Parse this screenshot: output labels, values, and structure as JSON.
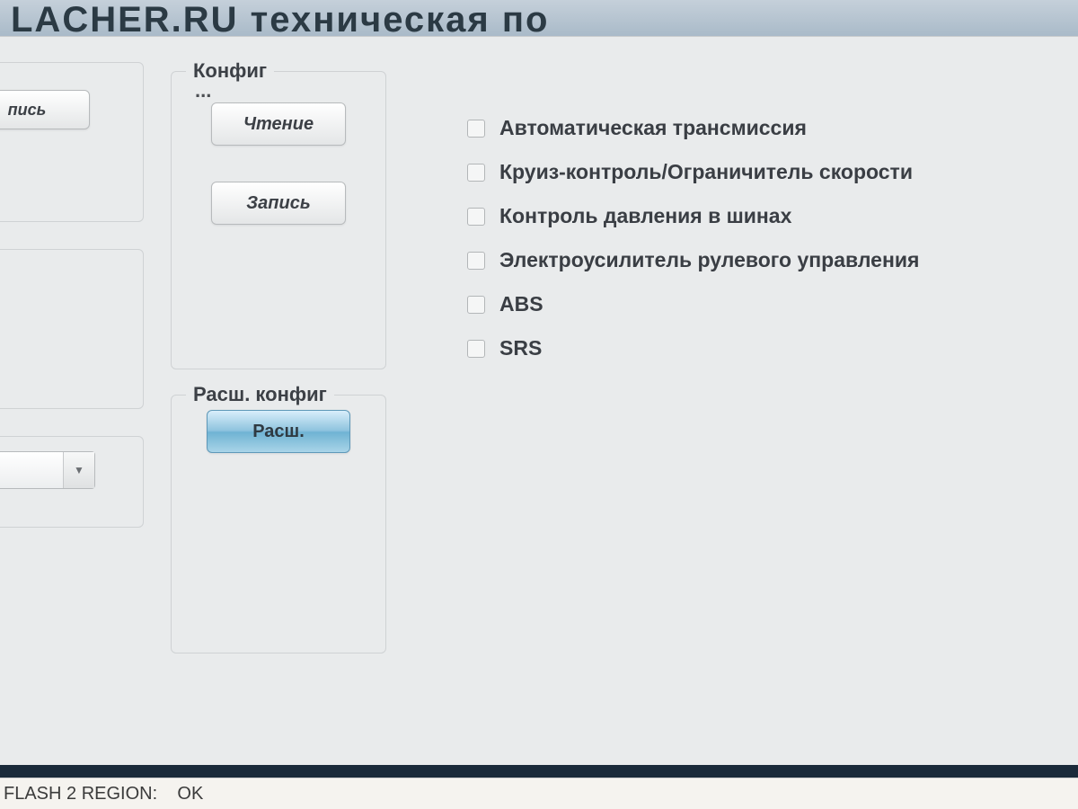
{
  "backdrop_text": "LACHER.RU техническая по",
  "left": {
    "write_button": "пись"
  },
  "combo": {
    "value": ""
  },
  "config": {
    "group_title": "Конфиг",
    "ellipsis": "...",
    "read_button": "Чтение",
    "write_button": "Запись"
  },
  "ext_config": {
    "group_title": "Расш. конфиг",
    "expand_button": "Расш."
  },
  "options": [
    {
      "label": "Автоматическая трансмиссия"
    },
    {
      "label": "Круиз-контроль/Ограничитель скорости"
    },
    {
      "label": "Контроль давления в шинах"
    },
    {
      "label": "Электроусилитель рулевого управления"
    },
    {
      "label": "ABS"
    },
    {
      "label": "SRS"
    }
  ],
  "status": {
    "label": "FLASH 2 REGION:",
    "value": "OK"
  }
}
